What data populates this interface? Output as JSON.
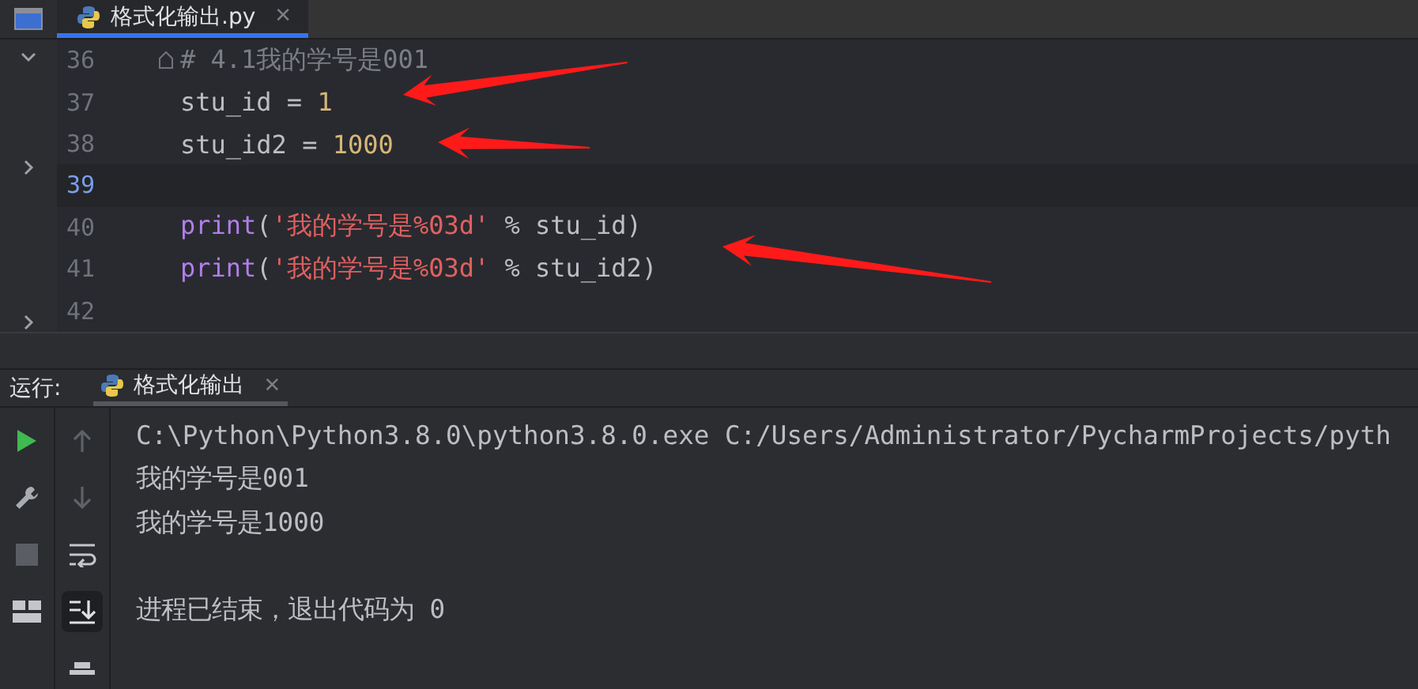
{
  "editor_tabs": [
    {
      "label": "格式化输出.py",
      "close": "✕",
      "selected": true
    }
  ],
  "code_lines": [
    {
      "number": "36",
      "current": false,
      "folded_start": true,
      "tokens": [
        {
          "kind": "comment",
          "text": "# 4.1我的学号是001"
        }
      ]
    },
    {
      "number": "37",
      "current": false,
      "tokens": [
        {
          "kind": "ident",
          "text": "stu_id = "
        },
        {
          "kind": "number",
          "text": "1"
        }
      ]
    },
    {
      "number": "38",
      "current": false,
      "tokens": [
        {
          "kind": "ident",
          "text": "stu_id2 = "
        },
        {
          "kind": "number",
          "text": "1000"
        }
      ]
    },
    {
      "number": "39",
      "current": true
    },
    {
      "number": "40",
      "current": false,
      "tokens": [
        {
          "kind": "builtin",
          "text": "print"
        },
        {
          "kind": "ident",
          "text": "("
        },
        {
          "kind": "string",
          "text": "'我的学号是%03d'"
        },
        {
          "kind": "ident",
          "text": " % stu_id)"
        }
      ]
    },
    {
      "number": "41",
      "current": false,
      "tokens": [
        {
          "kind": "builtin",
          "text": "print"
        },
        {
          "kind": "ident",
          "text": "("
        },
        {
          "kind": "string",
          "text": "'我的学号是%03d'"
        },
        {
          "kind": "ident",
          "text": " % stu_id2)"
        }
      ]
    },
    {
      "number": "42",
      "current": false
    }
  ],
  "run_panel": {
    "label": "运行:",
    "tabs": [
      {
        "label": "格式化输出",
        "close": "✕",
        "selected": true
      }
    ]
  },
  "run_tools": [
    {
      "kind": "run"
    },
    {
      "kind": "wrench"
    },
    {
      "kind": "stop"
    },
    {
      "kind": "layout"
    }
  ],
  "console_tools": [
    {
      "kind": "up",
      "selected": false
    },
    {
      "kind": "down",
      "selected": false
    },
    {
      "kind": "wrap",
      "selected": false
    },
    {
      "kind": "scroll_end",
      "selected": true
    },
    {
      "kind": "print",
      "selected": false
    }
  ],
  "console_lines": [
    {
      "kind": "output",
      "text": "C:\\Python\\Python3.8.0\\python3.8.0.exe C:/Users/Administrator/PycharmProjects/pyth"
    },
    {
      "kind": "output",
      "text": "我的学号是001"
    },
    {
      "kind": "output",
      "text": "我的学号是1000"
    },
    {
      "kind": "blank"
    },
    {
      "kind": "output",
      "text": "进程已结束，退出代码为 0"
    }
  ]
}
